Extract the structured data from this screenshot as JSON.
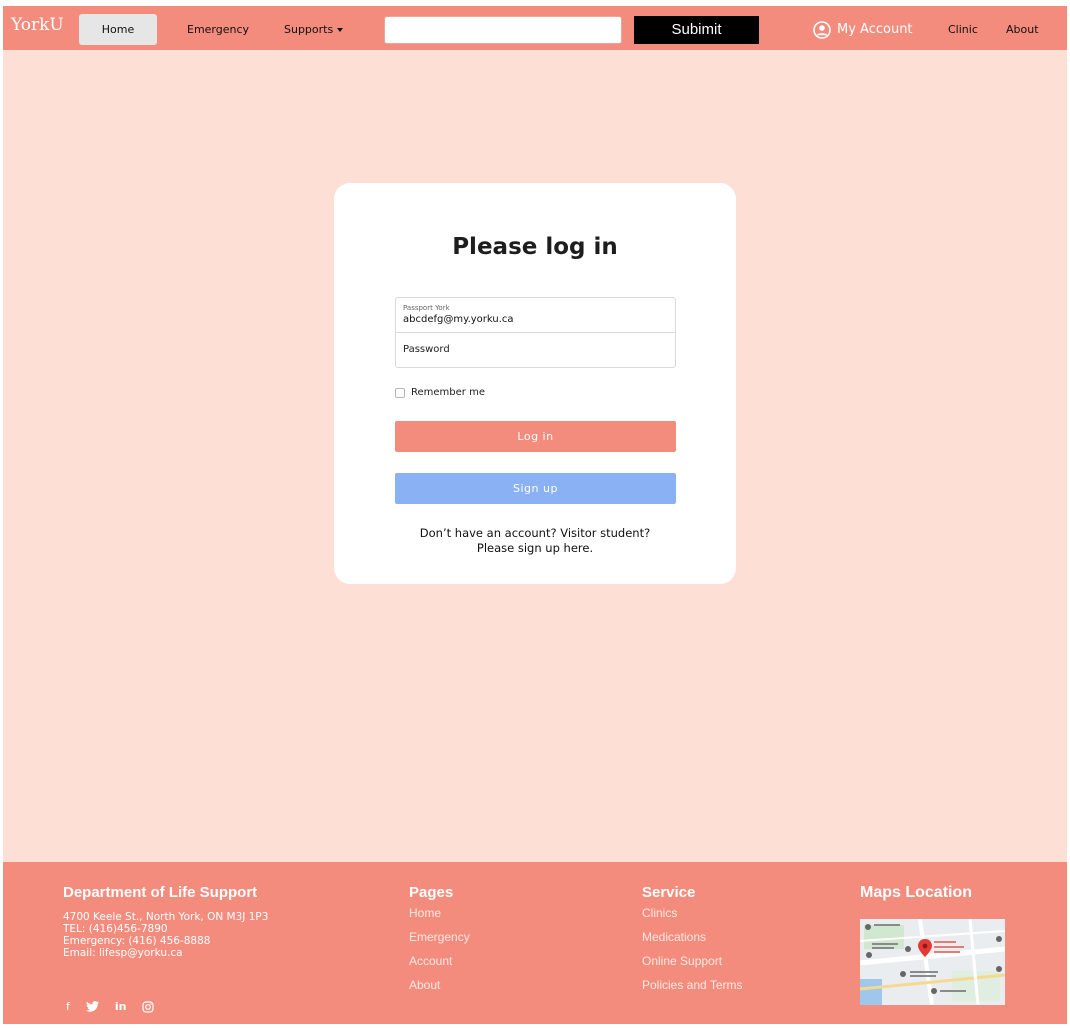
{
  "nav": {
    "brand": "YorkU",
    "home": "Home",
    "emergency": "Emergency",
    "supports": "Supports",
    "search_value": "",
    "submit": "Subimit",
    "account": "My Account",
    "clinic": "Clinic",
    "about": "About"
  },
  "login": {
    "title": "Please log in",
    "username_label": "Passport York",
    "username_value": "abcdefg@my.yorku.ca",
    "password_label": "Password",
    "remember": "Remember me",
    "login_button": "Log in",
    "signup_button": "Sign up",
    "note_line1": "Don’t have an account? Visitor student?",
    "note_line2": "Please sign up here."
  },
  "footer": {
    "dept": {
      "title": "Department of Life Support",
      "address": "4700 Keele St., North York, ON M3J 1P3",
      "tel": "TEL: (416)456-7890",
      "emergency": "Emergency: (416) 456-8888",
      "email": "Email: lifesp@yorku.ca"
    },
    "pages": {
      "title": "Pages",
      "items": [
        "Home",
        "Emergency",
        "Account",
        "About"
      ]
    },
    "service": {
      "title": "Service",
      "items": [
        "Clinics",
        "Medications",
        "Online Support",
        "Policies and Terms"
      ]
    },
    "maps": {
      "title": "Maps Location"
    },
    "social": {
      "facebook": "f",
      "linkedin": "in"
    }
  },
  "colors": {
    "brand": "#f48c7e",
    "page_bg": "#fedfd6",
    "signup": "#8ab1f4",
    "submit": "#000000"
  }
}
